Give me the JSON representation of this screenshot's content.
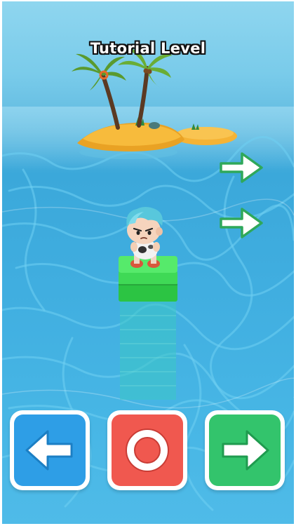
{
  "game": {
    "level_title": "Tutorial Level"
  },
  "hint_arrows": {
    "icon": "right-arrow-icon",
    "count": 2
  },
  "controls": {
    "left": {
      "icon": "left-arrow-icon",
      "color": "#2e9ee6"
    },
    "center": {
      "icon": "circle-icon",
      "color": "#f0584f"
    },
    "right": {
      "icon": "right-arrow-icon",
      "color": "#33c46c"
    }
  },
  "scene": {
    "platform_color": "#33d14a",
    "sand_color": "#f5b335",
    "sea_color": "#3ba8da"
  }
}
